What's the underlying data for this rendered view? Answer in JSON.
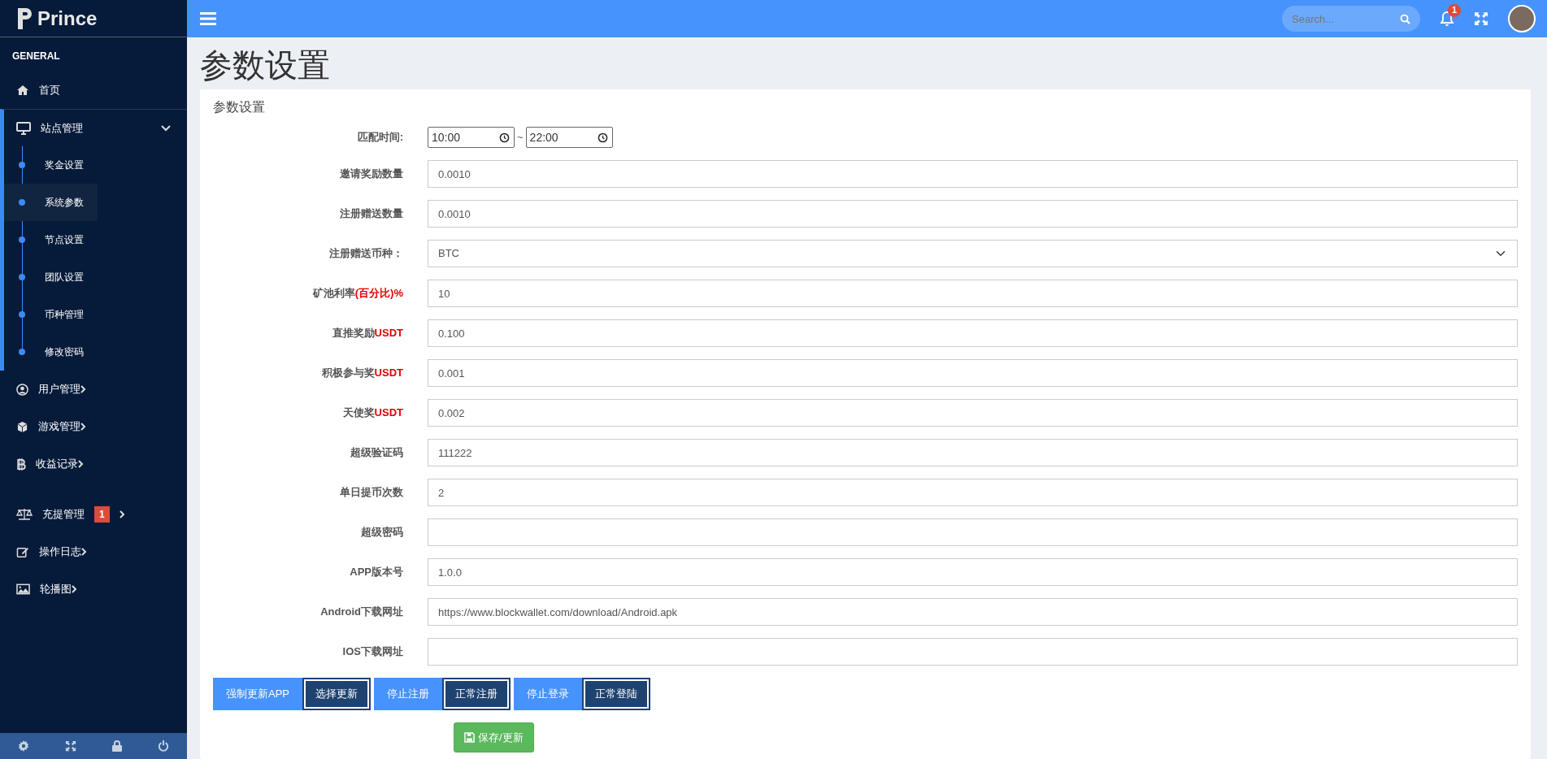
{
  "brand": {
    "name": "Prince"
  },
  "topbar": {
    "search": {
      "placeholder": "Search..."
    },
    "notifications": {
      "badge": "1"
    }
  },
  "sidebar": {
    "sections": [
      {
        "heading": "GENERAL",
        "items": [
          {
            "label": "首页"
          },
          {
            "label": "站点管理",
            "expanded": true,
            "children": [
              {
                "label": "奖金设置",
                "selected": false
              },
              {
                "label": "系统参数",
                "selected": true
              },
              {
                "label": "节点设置",
                "selected": false
              },
              {
                "label": "团队设置",
                "selected": false
              },
              {
                "label": "币种管理",
                "selected": false
              },
              {
                "label": "修改密码",
                "selected": false
              }
            ]
          },
          {
            "label": "用户管理",
            "expanded": false
          },
          {
            "label": "游戏管理",
            "expanded": false
          },
          {
            "label": "收益记录",
            "expanded": false
          }
        ]
      },
      {
        "items": [
          {
            "label": "充提管理",
            "expanded": false,
            "badge": "1"
          },
          {
            "label": "操作日志",
            "expanded": false
          },
          {
            "label": "轮播图",
            "expanded": false
          }
        ]
      }
    ]
  },
  "page": {
    "title": "参数设置"
  },
  "form": {
    "title": "参数设置",
    "fields": [
      {
        "kind": "timerange",
        "label": "匹配时间:",
        "from": "10:00",
        "separator": "~",
        "to": "22:00"
      },
      {
        "kind": "text",
        "label": "邀请奖励数量",
        "value": "0.0010"
      },
      {
        "kind": "text",
        "label": "注册赠送数量",
        "value": "0.0010"
      },
      {
        "kind": "select",
        "label": "注册赠送币种：",
        "value": "BTC"
      },
      {
        "kind": "text",
        "label": "矿池利率",
        "highlight": "(百分比)",
        "suffix": "%",
        "value": "10"
      },
      {
        "kind": "text",
        "label": "直推奖励",
        "highlight": "USDT",
        "value": "0.100"
      },
      {
        "kind": "text",
        "label": "积极参与奖",
        "highlight": "USDT",
        "value": "0.001"
      },
      {
        "kind": "text",
        "label": "天使奖",
        "highlight": "USDT",
        "value": "0.002"
      },
      {
        "kind": "text",
        "label": "超级验证码",
        "value": "111222"
      },
      {
        "kind": "text",
        "label": "单日提币次数",
        "value": "2"
      },
      {
        "kind": "text",
        "label": "超级密码"
      },
      {
        "kind": "text",
        "label": "APP版本号",
        "value": "1.0.0"
      },
      {
        "kind": "text",
        "label": "Android下载网址",
        "value": "https://www.blockwallet.com/download/Android.apk"
      },
      {
        "kind": "text",
        "label": "IOS下载网址"
      }
    ],
    "toggles": [
      {
        "options": [
          {
            "label": "强制更新APP",
            "selected": false
          },
          {
            "label": "选择更新",
            "selected": true
          }
        ]
      },
      {
        "options": [
          {
            "label": "停止注册",
            "selected": false
          },
          {
            "label": "正常注册",
            "selected": true
          }
        ]
      },
      {
        "options": [
          {
            "label": "停止登录",
            "selected": false
          },
          {
            "label": "正常登陆",
            "selected": true
          }
        ]
      }
    ],
    "save_button": "保存/更新"
  }
}
